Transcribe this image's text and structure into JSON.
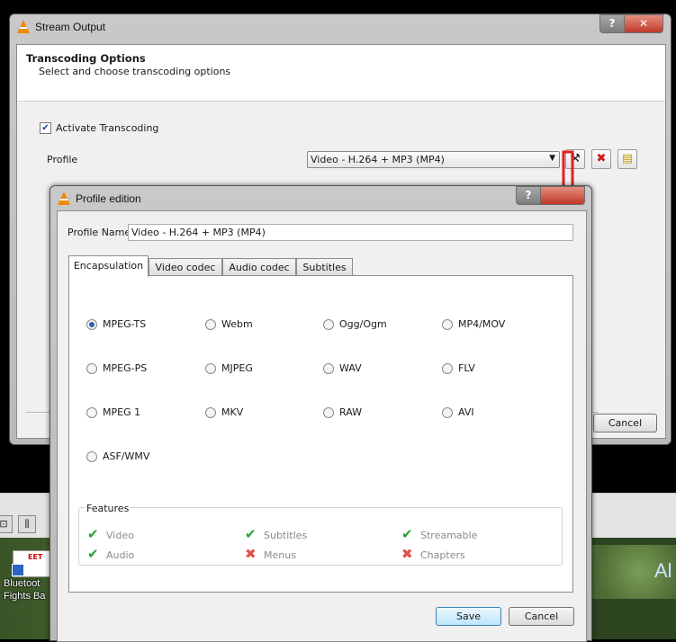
{
  "desktop": {
    "icon_label": "Bluetoot\nFights Ba",
    "icon_brand": "EET",
    "map_text": "Al"
  },
  "stream_output": {
    "title": "Stream Output",
    "help_label": "?",
    "close_label": "✕",
    "header_title": "Transcoding Options",
    "header_subtitle": "Select and choose transcoding options",
    "activate_checkbox": {
      "label": "Activate Transcoding",
      "checked": true
    },
    "profile_label": "Profile",
    "profile_value": "Video - H.264 + MP3 (MP4)",
    "cancel_label": "Cancel"
  },
  "profile_edition": {
    "title": "Profile edition",
    "help_label": "?",
    "profile_name_label": "Profile Name",
    "profile_name_value": "Video - H.264 + MP3 (MP4)",
    "tabs": [
      {
        "label": "Encapsulation",
        "active": true
      },
      {
        "label": "Video codec"
      },
      {
        "label": "Audio codec"
      },
      {
        "label": "Subtitles"
      }
    ],
    "encapsulations": [
      {
        "label": "MPEG-TS",
        "selected": true
      },
      {
        "label": "Webm"
      },
      {
        "label": "Ogg/Ogm"
      },
      {
        "label": "MP4/MOV"
      },
      {
        "label": "MPEG-PS"
      },
      {
        "label": "MJPEG"
      },
      {
        "label": "WAV"
      },
      {
        "label": "FLV"
      },
      {
        "label": "MPEG 1"
      },
      {
        "label": "MKV"
      },
      {
        "label": "RAW"
      },
      {
        "label": "AVI"
      },
      {
        "label": "ASF/WMV"
      }
    ],
    "features_title": "Features",
    "features": [
      {
        "label": "Video",
        "supported": true
      },
      {
        "label": "Subtitles",
        "supported": true
      },
      {
        "label": "Streamable",
        "supported": true
      },
      {
        "label": "Audio",
        "supported": true
      },
      {
        "label": "Menus",
        "supported": false
      },
      {
        "label": "Chapters",
        "supported": false
      }
    ],
    "save_label": "Save",
    "cancel_label": "Cancel"
  },
  "colors": {
    "vlc_orange": "#f08a00",
    "check_green": "#2ca02c",
    "cross_red": "#e0504a",
    "annotation_red": "#e02020"
  }
}
